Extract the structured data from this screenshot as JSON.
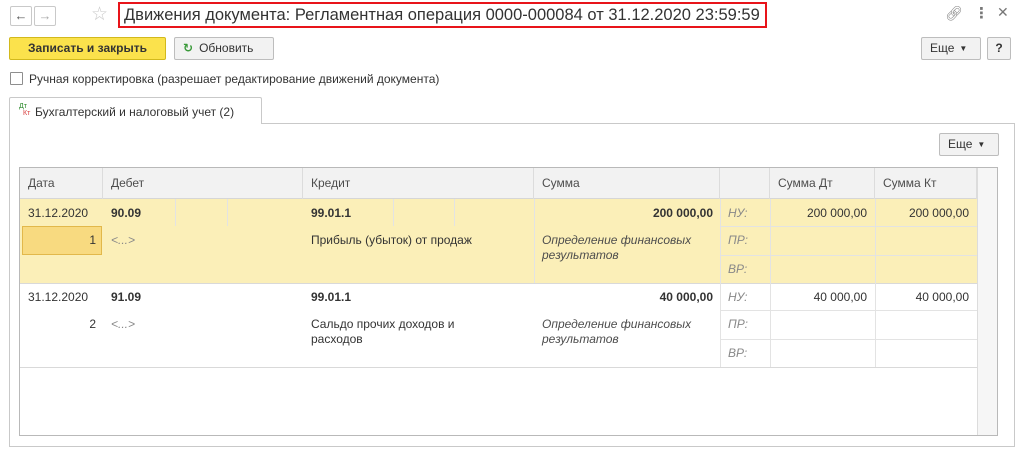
{
  "window": {
    "title": "Движения документа: Регламентная операция 0000-000084 от 31.12.2020 23:59:59",
    "back_icon": "arrow-left-icon",
    "forward_icon": "arrow-right-icon",
    "favorite_icon": "star-icon",
    "link_icon": "link-icon",
    "more_icon": "more-vert-icon",
    "close_icon": "close-icon"
  },
  "toolbar": {
    "save_close_label": "Записать и закрыть",
    "refresh_label": "Обновить",
    "more_label": "Еще",
    "help_label": "?"
  },
  "manual_correction": {
    "label": "Ручная корректировка (разрешает редактирование движений документа)",
    "checked": false
  },
  "tab": {
    "label": "Бухгалтерский и налоговый учет (2)",
    "icon_top": "Дт",
    "icon_bottom": "Кт"
  },
  "grid": {
    "more_label": "Еще",
    "columns": {
      "date": "Дата",
      "debit": "Дебет",
      "credit": "Кредит",
      "amount": "Сумма",
      "amount_dt": "Сумма Дт",
      "amount_kt": "Сумма Кт"
    },
    "rows": [
      {
        "date": "31.12.2020",
        "number": "1",
        "debit_account": "90.09",
        "debit_subconto": "<...>",
        "credit_account": "99.01.1",
        "credit_subconto": "Прибыль (убыток) от продаж",
        "amount": "200 000,00",
        "content": "Определение финансовых результатов",
        "nu": "НУ:",
        "pr": "ПР:",
        "vr": "ВР:",
        "amount_dt": "200 000,00",
        "amount_kt": "200 000,00"
      },
      {
        "date": "31.12.2020",
        "number": "2",
        "debit_account": "91.09",
        "debit_subconto": "<...>",
        "credit_account": "99.01.1",
        "credit_subconto": "Сальдо прочих доходов и расходов",
        "amount": "40 000,00",
        "content": "Определение финансовых результатов",
        "nu": "НУ:",
        "pr": "ПР:",
        "vr": "ВР:",
        "amount_dt": "40 000,00",
        "amount_kt": "40 000,00"
      }
    ]
  },
  "colors": {
    "primary_button": "#fbe24c",
    "selected_row": "#fbefb8",
    "selected_cell": "#f8da80",
    "title_highlight": "#e8141a"
  }
}
